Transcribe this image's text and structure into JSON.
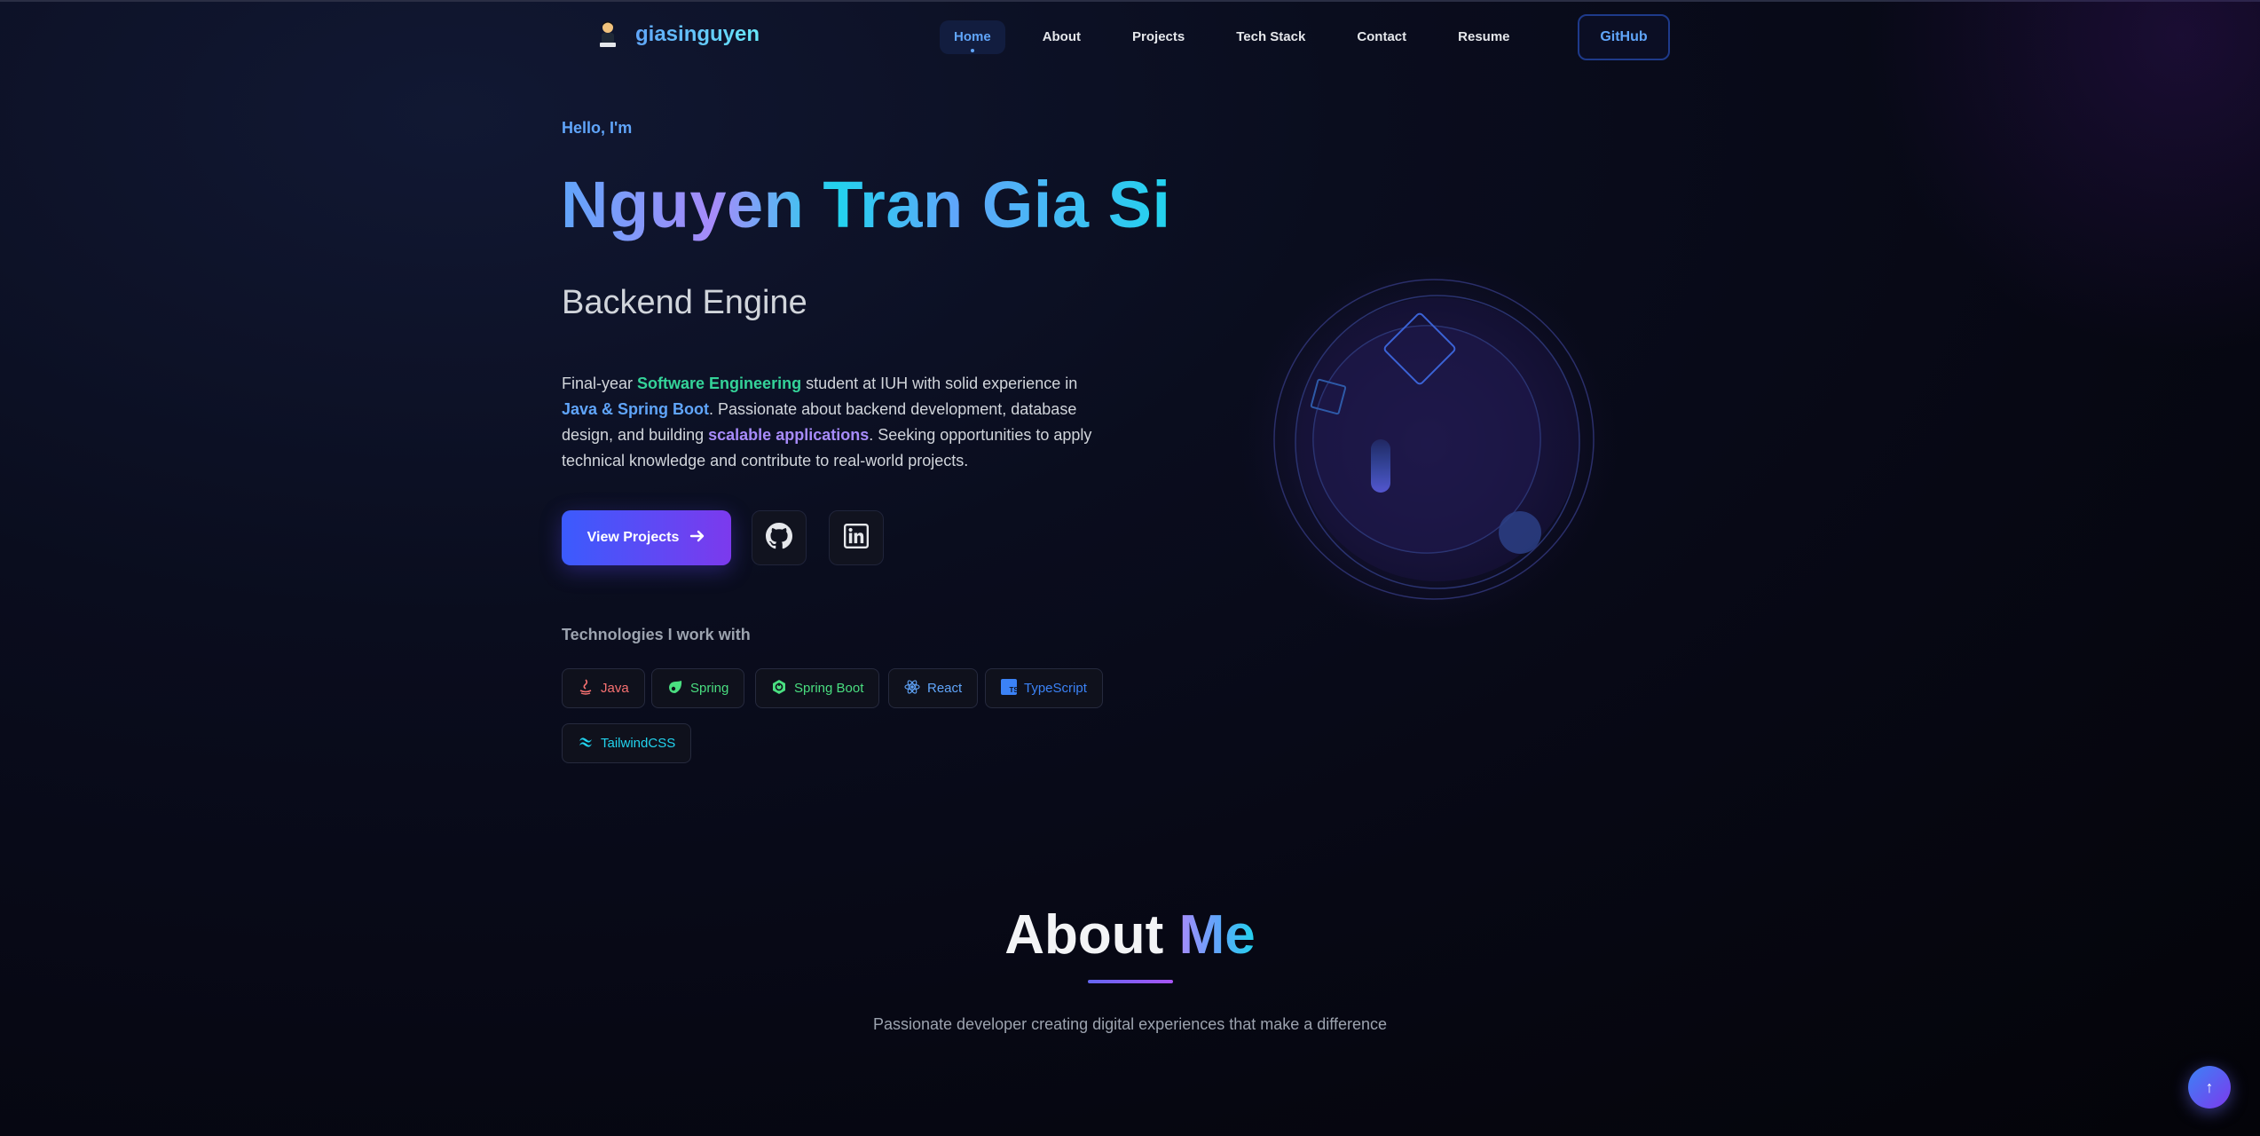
{
  "nav": {
    "brand": "giasinguyen",
    "links": [
      {
        "label": "Home",
        "active": true
      },
      {
        "label": "About"
      },
      {
        "label": "Projects"
      },
      {
        "label": "Tech Stack"
      },
      {
        "label": "Contact"
      },
      {
        "label": "Resume"
      }
    ],
    "github_label": "GitHub"
  },
  "hero": {
    "greeting": "Hello, I'm",
    "name": "Nguyen Tran Gia Si",
    "role": "Backend Engine",
    "desc": {
      "p1": "Final-year ",
      "h1": "Software Engineering",
      "p2": " student at IUH with solid experience in ",
      "h2": "Java & Spring Boot",
      "p3": ". Passionate about backend development, database design, and building ",
      "h3": "scalable applications",
      "p4": ". Seeking opportunities to apply technical knowledge and contribute to real-world projects."
    },
    "cta_label": "View Projects",
    "social_icons": [
      "github-icon",
      "linkedin-icon"
    ]
  },
  "tech": {
    "title": "Technologies I work with",
    "chips": [
      {
        "label": "Java",
        "icon": "java-icon",
        "color": "#f87171"
      },
      {
        "label": "Spring",
        "icon": "spring-icon",
        "color": "#4ade80"
      },
      {
        "label": "Spring Boot",
        "icon": "spring-boot-icon",
        "color": "#4ade80"
      },
      {
        "label": "React",
        "icon": "react-icon",
        "color": "#60a5fa"
      },
      {
        "label": "TypeScript",
        "icon": "typescript-icon",
        "color": "#3b82f6"
      },
      {
        "label": "TailwindCSS",
        "icon": "tailwind-icon",
        "color": "#22d3ee"
      }
    ]
  },
  "about": {
    "title_white": "About",
    "title_gradient": "Me",
    "subtitle": "Passionate developer creating digital experiences that make a difference"
  },
  "scroll_top_label": "↑",
  "colors": {
    "accent_blue": "#60a5fa",
    "accent_purple": "#7c3aed",
    "accent_cyan": "#22d3ee",
    "accent_green": "#34d399",
    "background": "#070814"
  }
}
